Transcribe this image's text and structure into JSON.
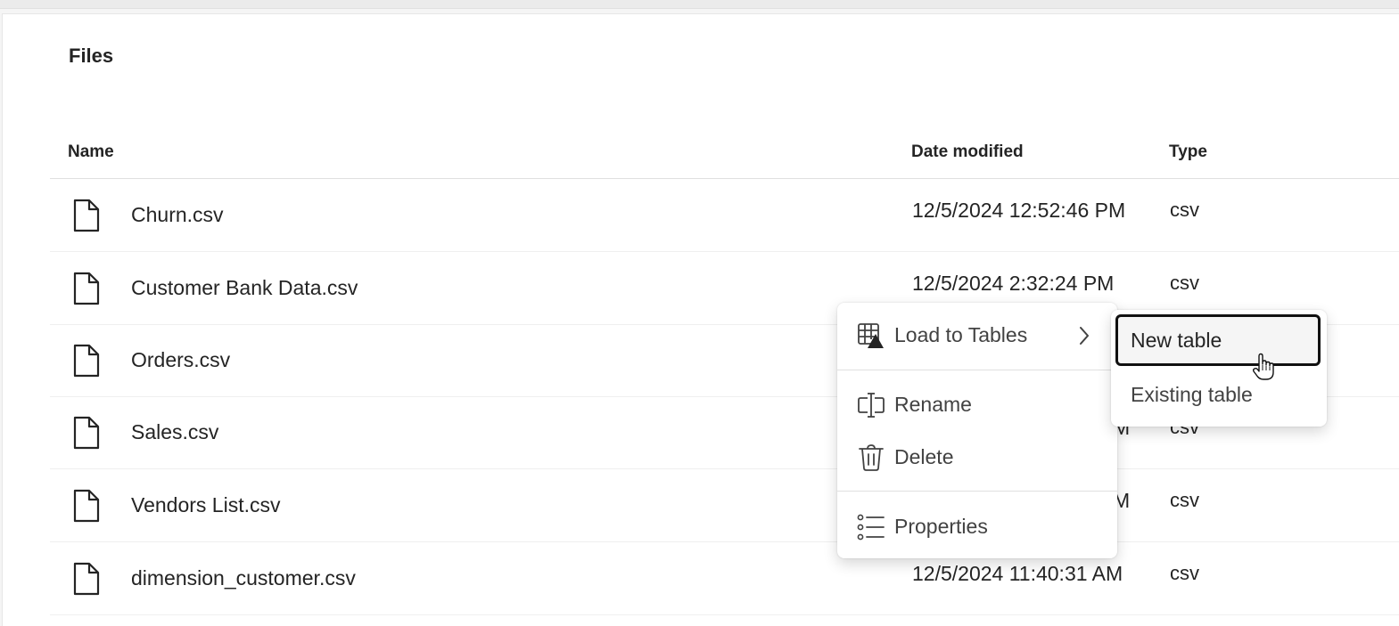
{
  "section": {
    "title": "Files"
  },
  "table": {
    "headers": {
      "name": "Name",
      "date": "Date modified",
      "type": "Type"
    },
    "rows": [
      {
        "name": "Churn.csv",
        "date": "12/5/2024 12:52:46 PM",
        "type": "csv"
      },
      {
        "name": "Customer Bank Data.csv",
        "date": "12/5/2024 2:32:24 PM",
        "type": "csv"
      },
      {
        "name": "Orders.csv",
        "date": "",
        "type": ""
      },
      {
        "name": "Sales.csv",
        "date": "M",
        "type": "csv"
      },
      {
        "name": "Vendors List.csv",
        "date": "M",
        "type": "csv"
      },
      {
        "name": "dimension_customer.csv",
        "date": "12/5/2024 11:40:31 AM",
        "type": "csv"
      }
    ]
  },
  "context_menu": {
    "items": [
      {
        "label": "Load to Tables",
        "icon": "table-load-icon",
        "has_submenu": true
      },
      {
        "label": "Rename",
        "icon": "rename-icon"
      },
      {
        "label": "Delete",
        "icon": "trash-icon"
      },
      {
        "label": "Properties",
        "icon": "list-icon"
      }
    ]
  },
  "submenu": {
    "items": [
      {
        "label": "New table",
        "focused": true
      },
      {
        "label": "Existing table"
      }
    ]
  }
}
